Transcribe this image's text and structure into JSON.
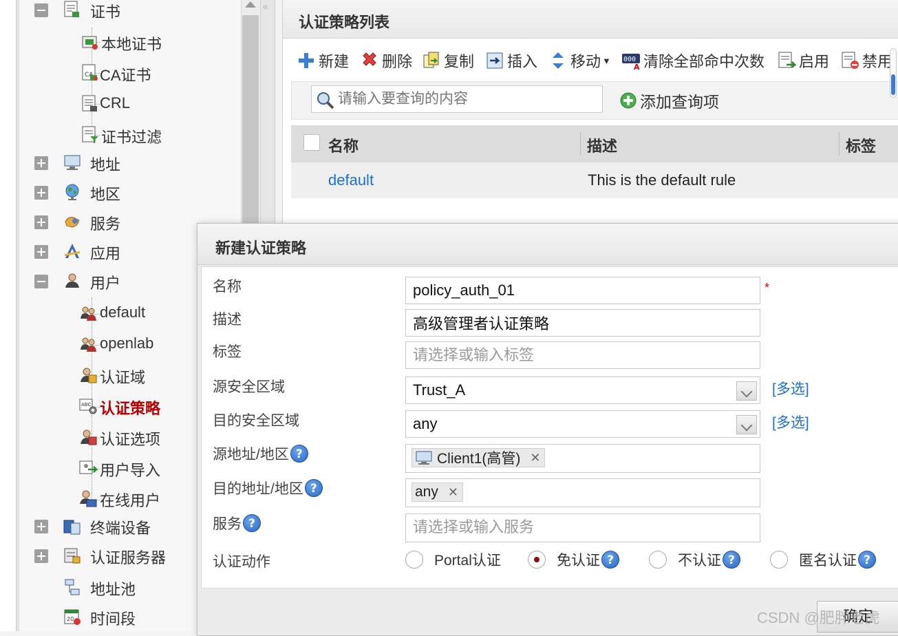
{
  "sidebar": {
    "items": [
      {
        "label": "证书",
        "toggle": "minus",
        "icon": "certificate-icon"
      },
      {
        "label": "本地证书",
        "icon": "local-certificate-icon"
      },
      {
        "label": "CA证书",
        "icon": "ca-certificate-icon"
      },
      {
        "label": "CRL",
        "icon": "crl-icon"
      },
      {
        "label": "证书过滤",
        "icon": "certificate-filter-icon"
      },
      {
        "label": "地址",
        "toggle": "plus",
        "icon": "monitor-icon"
      },
      {
        "label": "地区",
        "toggle": "plus",
        "icon": "globe-icon"
      },
      {
        "label": "服务",
        "toggle": "plus",
        "icon": "service-icon"
      },
      {
        "label": "应用",
        "toggle": "plus",
        "icon": "application-icon"
      },
      {
        "label": "用户",
        "toggle": "minus",
        "icon": "user-icon"
      },
      {
        "label": "default",
        "icon": "user-group-icon"
      },
      {
        "label": "openlab",
        "icon": "user-group-icon"
      },
      {
        "label": "认证域",
        "icon": "auth-domain-icon"
      },
      {
        "label": "认证策略",
        "icon": "auth-policy-icon",
        "selected": true
      },
      {
        "label": "认证选项",
        "icon": "auth-option-icon"
      },
      {
        "label": "用户导入",
        "icon": "user-import-icon"
      },
      {
        "label": "在线用户",
        "icon": "online-user-icon"
      },
      {
        "label": "终端设备",
        "toggle": "plus",
        "icon": "terminal-device-icon"
      },
      {
        "label": "认证服务器",
        "toggle": "plus",
        "icon": "auth-server-icon"
      },
      {
        "label": "地址池",
        "icon": "address-pool-icon"
      },
      {
        "label": "时间段",
        "icon": "calendar-icon"
      }
    ]
  },
  "panel": {
    "title": "认证策略列表",
    "toolbar": {
      "new": "新建",
      "delete": "删除",
      "copy": "复制",
      "insert": "插入",
      "move": "移动",
      "clear_hits": "清除全部命中次数",
      "enable": "启用",
      "disable": "禁用"
    },
    "search": {
      "placeholder": "请输入要查询的内容",
      "add_query": "添加查询项"
    },
    "grid": {
      "columns": [
        "名称",
        "描述",
        "标签"
      ],
      "rows": [
        {
          "name": "default",
          "description": "This is the default rule"
        }
      ]
    }
  },
  "dialog": {
    "title": "新建认证策略",
    "labels": {
      "name": "名称",
      "description": "描述",
      "tag": "标签",
      "src_zone": "源安全区域",
      "dst_zone": "目的安全区域",
      "src_addr": "源地址/地区",
      "dst_addr": "目的地址/地区",
      "service": "服务",
      "action": "认证动作"
    },
    "values": {
      "name": "policy_auth_01",
      "description": "高级管理者认证策略",
      "src_zone": "Trust_A",
      "dst_zone": "any",
      "src_addr_tag": "Client1(高管)",
      "dst_addr_tag": "any"
    },
    "placeholders": {
      "tag": "请选择或输入标签",
      "service": "请选择或输入服务"
    },
    "required_mark": "*",
    "multi_select": "[多选]",
    "help": "?",
    "tag_remove": "✕",
    "actions": [
      {
        "label": "Portal认证",
        "checked": false,
        "help": false
      },
      {
        "label": "免认证",
        "checked": true,
        "help": true
      },
      {
        "label": "不认证",
        "checked": false,
        "help": true
      },
      {
        "label": "匿名认证",
        "checked": false,
        "help": true
      }
    ],
    "ok": "确定"
  },
  "watermark": "CSDN @肥胖老虎",
  "colors": {
    "link": "#1a6fd1",
    "selected": "#b00000",
    "required": "#dd0000",
    "radio_checked": "#8a0d0d"
  }
}
